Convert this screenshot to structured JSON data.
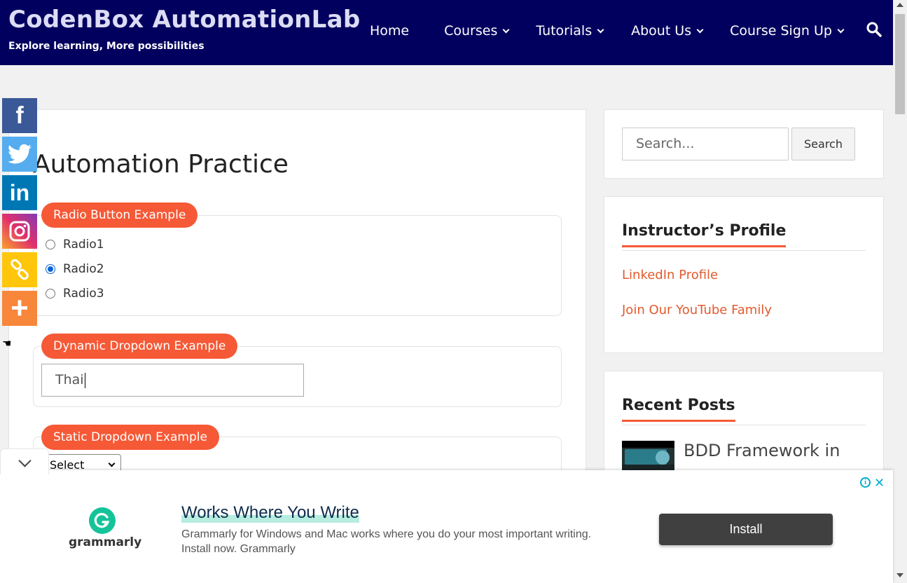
{
  "header": {
    "site_title": "CodenBox AutomationLab",
    "tagline": "Explore learning, More possibilities",
    "nav": [
      {
        "label": "Home",
        "has_dropdown": false
      },
      {
        "label": "Courses",
        "has_dropdown": true
      },
      {
        "label": "Tutorials",
        "has_dropdown": true
      },
      {
        "label": "About Us",
        "has_dropdown": true
      },
      {
        "label": "Course Sign Up",
        "has_dropdown": true
      }
    ],
    "search_icon": "search-icon",
    "bg_color": "#02005e"
  },
  "share_bar": [
    {
      "name": "facebook",
      "glyph": "f",
      "color": "#3b5998"
    },
    {
      "name": "twitter",
      "color": "#55acee"
    },
    {
      "name": "linkedin",
      "glyph": "in",
      "color": "#0077b5"
    },
    {
      "name": "instagram",
      "color": "#c13584"
    },
    {
      "name": "copy-link",
      "color": "#ffc60b"
    },
    {
      "name": "more",
      "glyph": "+",
      "color": "#f8863b"
    }
  ],
  "main": {
    "page_title": "Automation Practice",
    "radio_section": {
      "legend": "Radio Button Example",
      "options": [
        {
          "label": "Radio1",
          "checked": false
        },
        {
          "label": "Radio2",
          "checked": true
        },
        {
          "label": "Radio3",
          "checked": false
        }
      ]
    },
    "dynamic_dropdown": {
      "legend": "Dynamic Dropdown Example",
      "value": "Thai"
    },
    "static_dropdown": {
      "legend": "Static Dropdown Example",
      "selected": "Select"
    },
    "accent_color": "#f65936"
  },
  "sidebar": {
    "search": {
      "placeholder": "Search...",
      "button": "Search"
    },
    "instructor": {
      "title": "Instructor’s Profile",
      "links": [
        "LinkedIn Profile",
        "Join Our YouTube Family"
      ]
    },
    "recent_posts": {
      "title": "Recent Posts",
      "posts": [
        {
          "title": "BDD Framework in"
        }
      ]
    }
  },
  "ad": {
    "brand": "grammarly",
    "headline": "Works Where You Write",
    "body": "Grammarly for Windows and Mac works where you do your most important writing. Install now. Grammarly",
    "cta": "Install",
    "info_glyph": "i",
    "close_glyph": "✕"
  }
}
